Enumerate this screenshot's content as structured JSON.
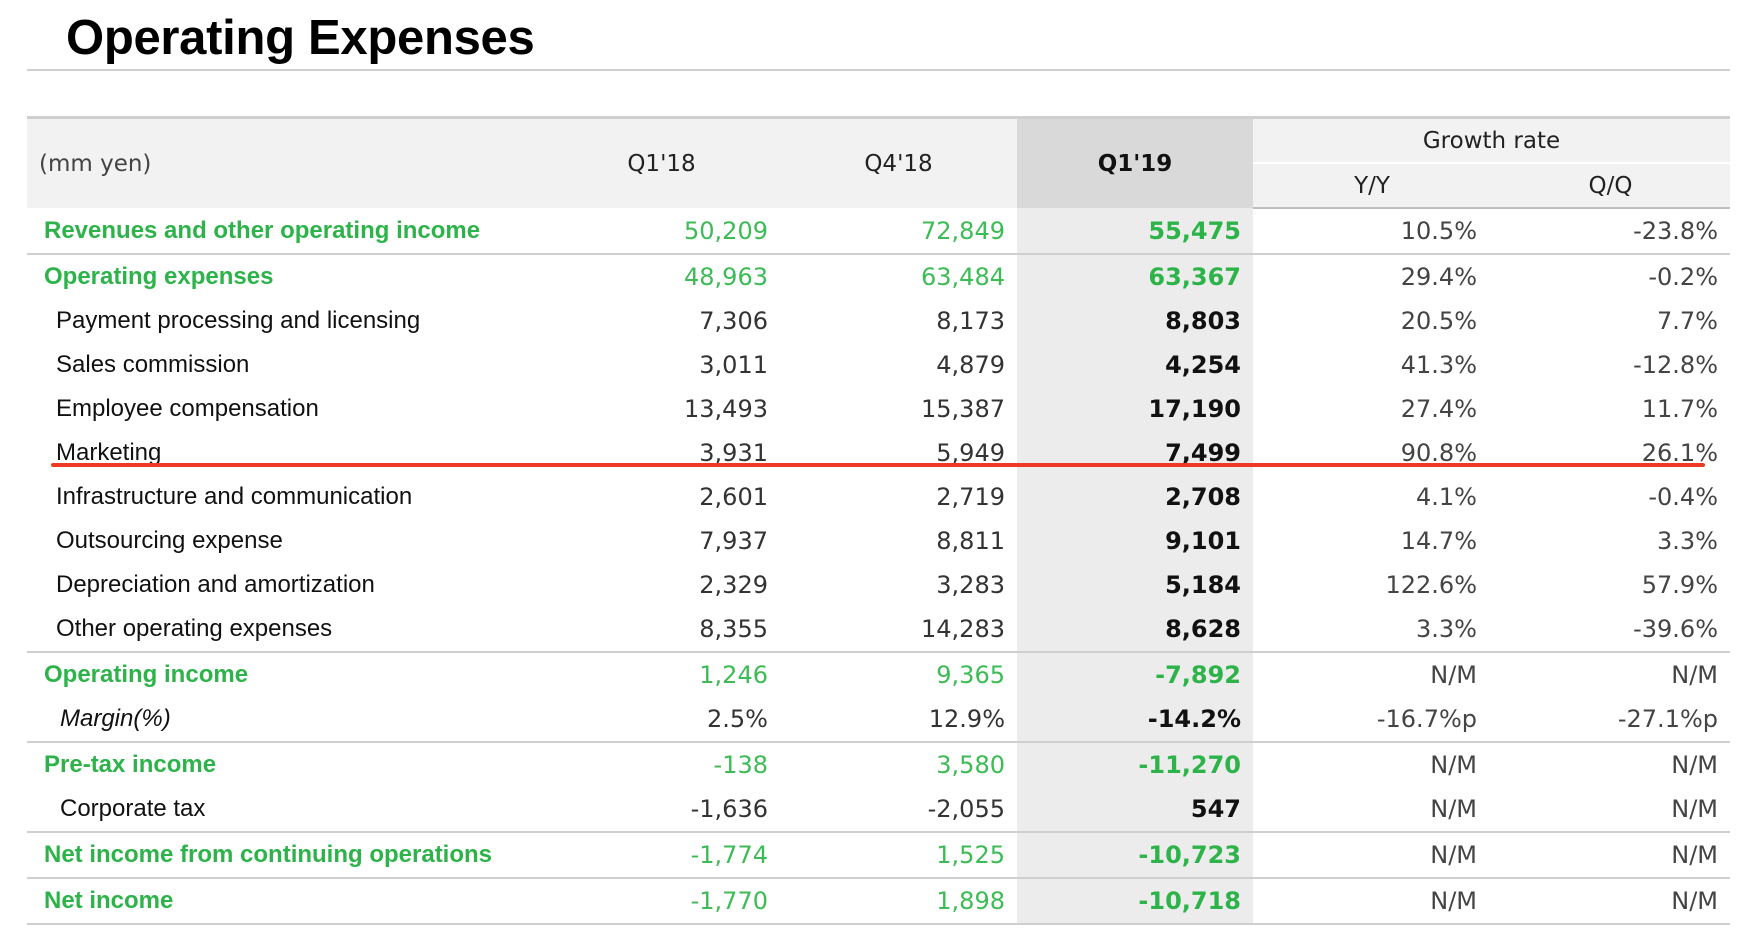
{
  "title": "Operating Expenses",
  "colors": {
    "accent_green": "#2eb34a",
    "highlight_column": "#ececec",
    "marker_line": "#ee3a24"
  },
  "table": {
    "unit_label": "(mm yen)",
    "columns": [
      "Q1'18",
      "Q4'18",
      "Q1'19"
    ],
    "growth_header": "Growth rate",
    "growth_columns": [
      "Y/Y",
      "Q/Q"
    ],
    "rows": [
      {
        "label": "Revenues and other operating income",
        "q1_18": "50,209",
        "q4_18": "72,849",
        "q1_19": "55,475",
        "yy": "10.5%",
        "qq": "-23.8%"
      },
      {
        "label": "Operating expenses",
        "q1_18": "48,963",
        "q4_18": "63,484",
        "q1_19": "63,367",
        "yy": "29.4%",
        "qq": "-0.2%"
      },
      {
        "label": "Payment processing and licensing",
        "q1_18": "7,306",
        "q4_18": "8,173",
        "q1_19": "8,803",
        "yy": "20.5%",
        "qq": "7.7%"
      },
      {
        "label": "Sales commission",
        "q1_18": "3,011",
        "q4_18": "4,879",
        "q1_19": "4,254",
        "yy": "41.3%",
        "qq": "-12.8%"
      },
      {
        "label": "Employee compensation",
        "q1_18": "13,493",
        "q4_18": "15,387",
        "q1_19": "17,190",
        "yy": "27.4%",
        "qq": "11.7%"
      },
      {
        "label": "Marketing",
        "q1_18": "3,931",
        "q4_18": "5,949",
        "q1_19": "7,499",
        "yy": "90.8%",
        "qq": "26.1%"
      },
      {
        "label": "Infrastructure and communication",
        "q1_18": "2,601",
        "q4_18": "2,719",
        "q1_19": "2,708",
        "yy": "4.1%",
        "qq": "-0.4%"
      },
      {
        "label": "Outsourcing expense",
        "q1_18": "7,937",
        "q4_18": "8,811",
        "q1_19": "9,101",
        "yy": "14.7%",
        "qq": "3.3%"
      },
      {
        "label": "Depreciation and amortization",
        "q1_18": "2,329",
        "q4_18": "3,283",
        "q1_19": "5,184",
        "yy": "122.6%",
        "qq": "57.9%"
      },
      {
        "label": "Other operating expenses",
        "q1_18": "8,355",
        "q4_18": "14,283",
        "q1_19": "8,628",
        "yy": "3.3%",
        "qq": "-39.6%"
      },
      {
        "label": "Operating income",
        "q1_18": "1,246",
        "q4_18": "9,365",
        "q1_19": "-7,892",
        "yy": "N/M",
        "qq": "N/M"
      },
      {
        "label": "Margin(%)",
        "q1_18": "2.5%",
        "q4_18": "12.9%",
        "q1_19": "-14.2%",
        "yy": "-16.7%p",
        "qq": "-27.1%p"
      },
      {
        "label": "Pre-tax income",
        "q1_18": "-138",
        "q4_18": "3,580",
        "q1_19": "-11,270",
        "yy": "N/M",
        "qq": "N/M"
      },
      {
        "label": "Corporate tax",
        "q1_18": "-1,636",
        "q4_18": "-2,055",
        "q1_19": "547",
        "yy": "N/M",
        "qq": "N/M"
      },
      {
        "label": "Net income from continuing operations",
        "q1_18": "-1,774",
        "q4_18": "1,525",
        "q1_19": "-10,723",
        "yy": "N/M",
        "qq": "N/M"
      },
      {
        "label": "Net income",
        "q1_18": "-1,770",
        "q4_18": "1,898",
        "q1_19": "-10,718",
        "yy": "N/M",
        "qq": "N/M"
      }
    ]
  }
}
